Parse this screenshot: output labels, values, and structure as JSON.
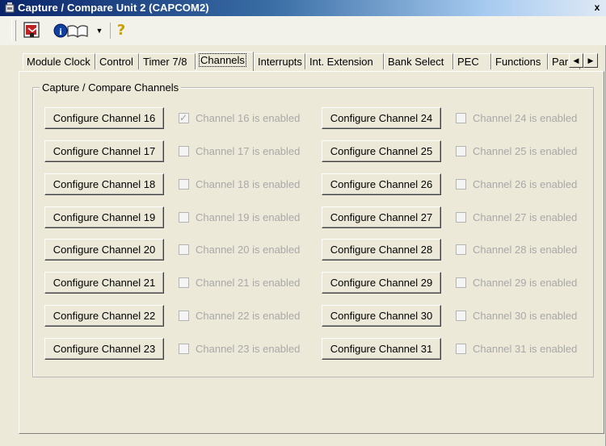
{
  "window": {
    "title": "Capture / Compare Unit 2 (CAPCOM2)",
    "close_glyph": "x"
  },
  "toolbar": {
    "exit_icon": "exit-door-icon",
    "info_icon": "info-book-icon",
    "dropdown_icon": "dropdown-arrow-icon",
    "help_label": "?"
  },
  "tabs": [
    {
      "label": "Module Clock",
      "active": false
    },
    {
      "label": "Control",
      "active": false
    },
    {
      "label": "Timer 7/8",
      "active": false
    },
    {
      "label": "Channels",
      "active": true
    },
    {
      "label": "Interrupts",
      "active": false
    },
    {
      "label": "Int. Extension",
      "active": false
    },
    {
      "label": "Bank Select",
      "active": false
    },
    {
      "label": "PEC",
      "active": false
    },
    {
      "label": "Functions",
      "active": false
    },
    {
      "label": "Par",
      "active": false
    }
  ],
  "tab_scroll": {
    "left": "◀",
    "right": "▶"
  },
  "group": {
    "title": "Capture / Compare Channels"
  },
  "channels_left": [
    {
      "button": "Configure Channel 16",
      "check": "Channel 16 is enabled",
      "checked": true
    },
    {
      "button": "Configure Channel 17",
      "check": "Channel 17 is enabled",
      "checked": false
    },
    {
      "button": "Configure Channel 18",
      "check": "Channel 18 is enabled",
      "checked": false
    },
    {
      "button": "Configure Channel 19",
      "check": "Channel 19 is enabled",
      "checked": false
    },
    {
      "button": "Configure Channel 20",
      "check": "Channel 20 is enabled",
      "checked": false
    },
    {
      "button": "Configure Channel 21",
      "check": "Channel 21 is enabled",
      "checked": false
    },
    {
      "button": "Configure Channel 22",
      "check": "Channel 22 is enabled",
      "checked": false
    },
    {
      "button": "Configure Channel 23",
      "check": "Channel 23 is enabled",
      "checked": false
    }
  ],
  "channels_right": [
    {
      "button": "Configure Channel 24",
      "check": "Channel 24 is enabled",
      "checked": false
    },
    {
      "button": "Configure Channel 25",
      "check": "Channel 25 is enabled",
      "checked": false
    },
    {
      "button": "Configure Channel 26",
      "check": "Channel 26 is enabled",
      "checked": false
    },
    {
      "button": "Configure Channel 27",
      "check": "Channel 27 is enabled",
      "checked": false
    },
    {
      "button": "Configure Channel 28",
      "check": "Channel 28 is enabled",
      "checked": false
    },
    {
      "button": "Configure Channel 29",
      "check": "Channel 29 is enabled",
      "checked": false
    },
    {
      "button": "Configure Channel 30",
      "check": "Channel 30 is enabled",
      "checked": false
    },
    {
      "button": "Configure Channel 31",
      "check": "Channel 31 is enabled",
      "checked": false
    }
  ]
}
